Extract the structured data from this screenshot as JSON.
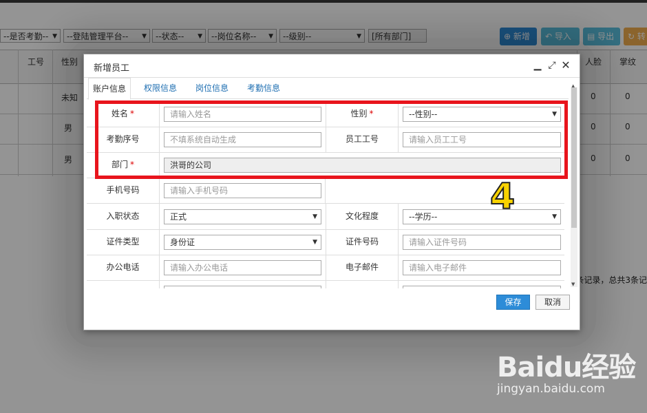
{
  "background": {
    "filters": [
      "--是否考勤--",
      "--登陆管理平台--",
      "--状态--",
      "--岗位名称--",
      "--级别--",
      "[所有部门]"
    ],
    "toolbar": {
      "add_label": "新增",
      "import_label": "导入",
      "export_label": "导出",
      "transfer_label": "转"
    },
    "columns": {
      "job_no": "工号",
      "gender": "性别",
      "face": "人脸",
      "fingerprint": "掌纹"
    },
    "rows": [
      {
        "gender": "未知",
        "face": "0",
        "fingerprint": "0"
      },
      {
        "gender": "男",
        "face": "0",
        "fingerprint": "0"
      },
      {
        "gender": "男",
        "face": "0",
        "fingerprint": "0"
      }
    ],
    "pager_text": "3条记录，总共3条记"
  },
  "dialog": {
    "title": "新增员工",
    "tabs": [
      "账户信息",
      "权限信息",
      "岗位信息",
      "考勤信息"
    ],
    "form": {
      "name_label": "姓名",
      "name_placeholder": "请输入姓名",
      "gender_label": "性别",
      "gender_value": "--性别--",
      "attendance_no_label": "考勤序号",
      "attendance_no_placeholder": "不填系统自动生成",
      "employee_no_label": "员工工号",
      "employee_no_placeholder": "请输入员工工号",
      "dept_label": "部门",
      "dept_value": "洪哥的公司",
      "phone_label": "手机号码",
      "phone_placeholder": "请输入手机号码",
      "status_label": "入职状态",
      "status_value": "正式",
      "education_label": "文化程度",
      "education_value": "--学历--",
      "id_type_label": "证件类型",
      "id_type_value": "身份证",
      "id_no_label": "证件号码",
      "id_no_placeholder": "请输入证件号码",
      "office_phone_label": "办公电话",
      "office_phone_placeholder": "请输入办公电话",
      "email_label": "电子邮件",
      "email_placeholder": "请输入电子邮件",
      "required_mark": "*"
    },
    "save_label": "保存",
    "cancel_label": "取消"
  },
  "annotation": {
    "step_number": "4"
  },
  "watermark": {
    "logo": "Baidu经验",
    "url": "jingyan.baidu.com"
  },
  "colors": {
    "primary_button": "#2d8cd8",
    "annotation_box": "#e8141c",
    "annotation_number": "#f8d200"
  }
}
